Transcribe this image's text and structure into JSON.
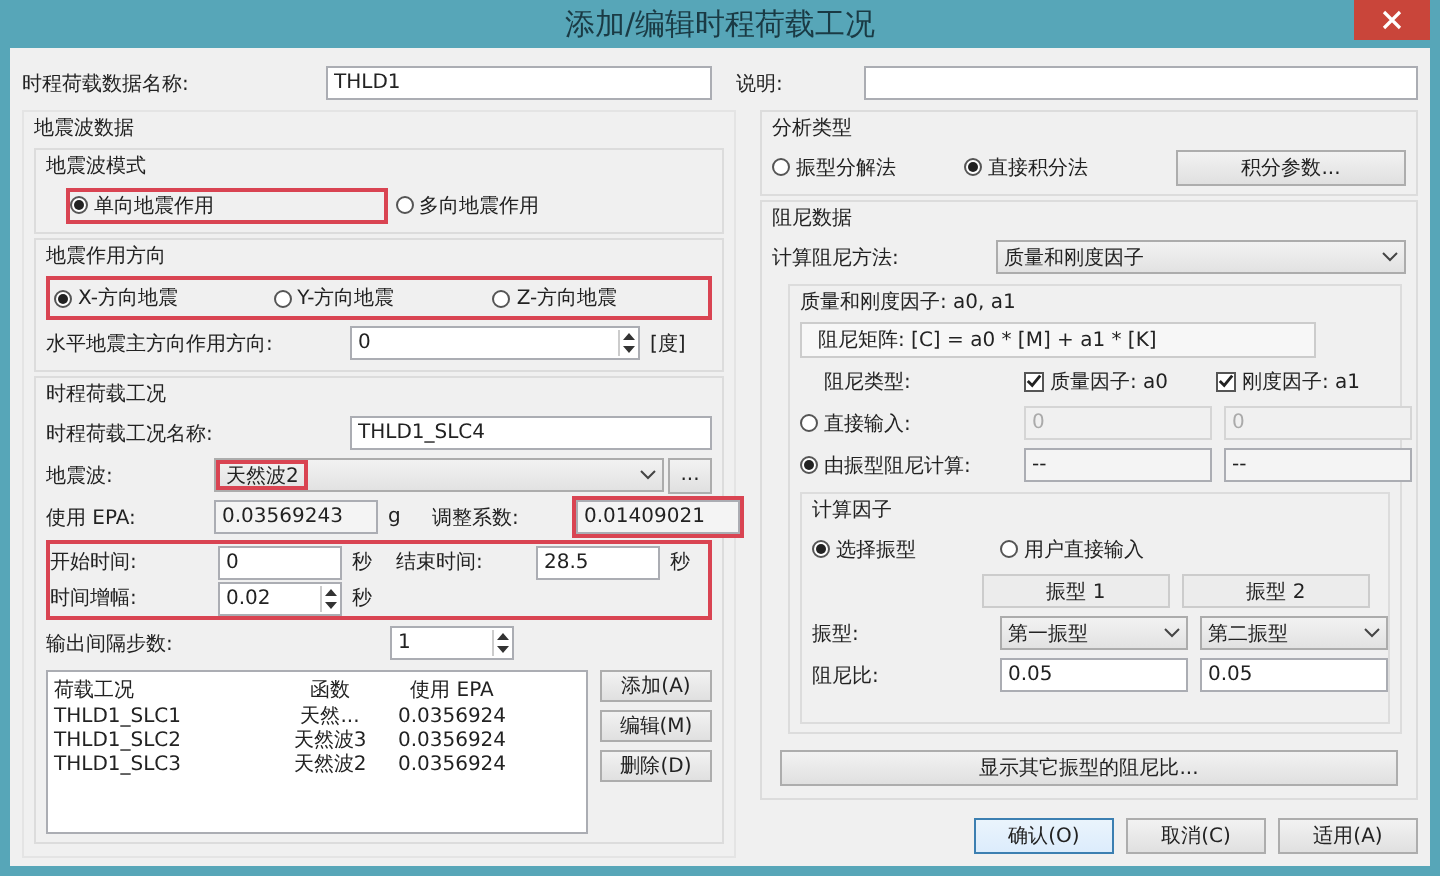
{
  "window": {
    "title": "添加/编辑时程荷载工况"
  },
  "name_field": {
    "label": "时程荷载数据名称:",
    "value": "THLD1"
  },
  "description_field": {
    "label": "说明:"
  },
  "seismic": {
    "title": "地震波数据",
    "mode": {
      "title": "地震波模式",
      "options": [
        {
          "label": "单向地震作用",
          "selected": true,
          "highlighted": true
        },
        {
          "label": "多向地震作用",
          "selected": false,
          "highlighted": false
        }
      ]
    },
    "direction": {
      "title": "地震作用方向",
      "highlighted": true,
      "options": [
        {
          "label": "X-方向地震",
          "selected": true
        },
        {
          "label": "Y-方向地震",
          "selected": false
        },
        {
          "label": "Z-方向地震",
          "selected": false
        }
      ],
      "angle": {
        "label": "水平地震主方向作用方向:",
        "value": "0",
        "unit": "[度]"
      }
    },
    "case": {
      "title": "时程荷载工况",
      "name": {
        "label": "时程荷载工况名称:",
        "value": "THLD1_SLC4"
      },
      "wave": {
        "label": "地震波:",
        "value": "天然波2",
        "button": "...",
        "highlighted": true
      },
      "epa": {
        "label": "使用 EPA:",
        "value": "0.03569243",
        "unit": "g"
      },
      "scale": {
        "label": "调整系数:",
        "value": "0.01409021",
        "highlighted": true
      },
      "time": {
        "highlighted": true,
        "start": {
          "label": "开始时间:",
          "value": "0",
          "unit": "秒"
        },
        "end": {
          "label": "结束时间:",
          "value": "28.5",
          "unit": "秒"
        },
        "step": {
          "label": "时间增幅:",
          "value": "0.02",
          "unit": "秒"
        }
      },
      "output_step": {
        "label": "输出间隔步数:",
        "value": "1"
      },
      "table": {
        "columns": [
          "荷载工况",
          "函数",
          "使用 EPA"
        ],
        "rows": [
          [
            "THLD1_SLC1",
            "天然...",
            "0.0356924"
          ],
          [
            "THLD1_SLC2",
            "天然波3",
            "0.0356924"
          ],
          [
            "THLD1_SLC3",
            "天然波2",
            "0.0356924"
          ]
        ]
      },
      "actions": [
        "添加(A)",
        "编辑(M)",
        "删除(D)"
      ]
    }
  },
  "analysis": {
    "title": "分析类型",
    "options": [
      {
        "label": "振型分解法",
        "selected": false
      },
      {
        "label": "直接积分法",
        "selected": true
      }
    ],
    "button": "积分参数..."
  },
  "damping": {
    "title": "阻尼数据",
    "method": {
      "label": "计算阻尼方法:",
      "value": "质量和刚度因子"
    },
    "factors": {
      "title": "质量和刚度因子: a0, a1",
      "formula": "阻尼矩阵: [C] = a0 * [M] + a1 * [K]",
      "type_label": "阻尼类型:",
      "checks": [
        {
          "label": "质量因子: a0",
          "checked": true
        },
        {
          "label": "刚度因子: a1",
          "checked": true
        }
      ],
      "inputs": [
        {
          "label": "直接输入:",
          "selected": false,
          "values": [
            "0",
            "0"
          ]
        },
        {
          "label": "由振型阻尼计算:",
          "selected": true,
          "values": [
            "--",
            "--"
          ]
        }
      ],
      "calc": {
        "title": "计算因子",
        "options": [
          {
            "label": "选择振型",
            "selected": true
          },
          {
            "label": "用户直接输入",
            "selected": false
          }
        ],
        "headers": [
          "振型 1",
          "振型 2"
        ],
        "mode_label": "振型:",
        "modes": [
          "第一振型",
          "第二振型"
        ],
        "ratio_label": "阻尼比:",
        "ratios": [
          "0.05",
          "0.05"
        ]
      }
    },
    "more_button": "显示其它振型的阻尼比..."
  },
  "buttons": [
    {
      "label": "确认(O)",
      "default": true
    },
    {
      "label": "取消(C)",
      "default": false
    },
    {
      "label": "适用(A)",
      "default": false
    }
  ]
}
